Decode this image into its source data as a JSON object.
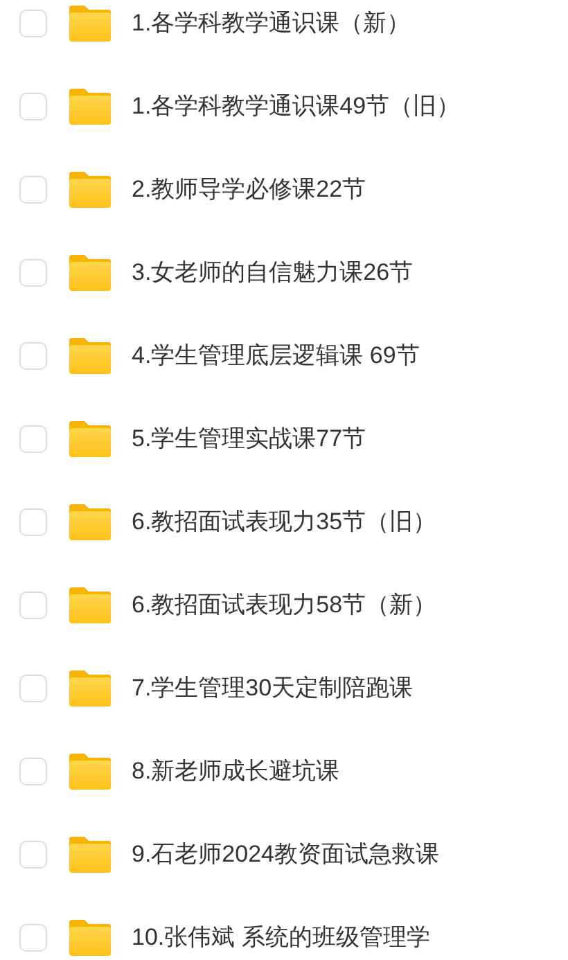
{
  "files": [
    {
      "name": "1.各学科教学通识课（新）",
      "checked": false
    },
    {
      "name": "1.各学科教学通识课49节（旧）",
      "checked": false
    },
    {
      "name": "2.教师导学必修课22节",
      "checked": false
    },
    {
      "name": "3.女老师的自信魅力课26节",
      "checked": false
    },
    {
      "name": "4.学生管理底层逻辑课 69节",
      "checked": false
    },
    {
      "name": "5.学生管理实战课77节",
      "checked": false
    },
    {
      "name": "6.教招面试表现力35节（旧）",
      "checked": false
    },
    {
      "name": "6.教招面试表现力58节（新）",
      "checked": false
    },
    {
      "name": "7.学生管理30天定制陪跑课",
      "checked": false
    },
    {
      "name": "8.新老师成长避坑课",
      "checked": false
    },
    {
      "name": "9.石老师2024教资面试急救课",
      "checked": false
    },
    {
      "name": "10.张伟斌 系统的班级管理学",
      "checked": false
    }
  ]
}
